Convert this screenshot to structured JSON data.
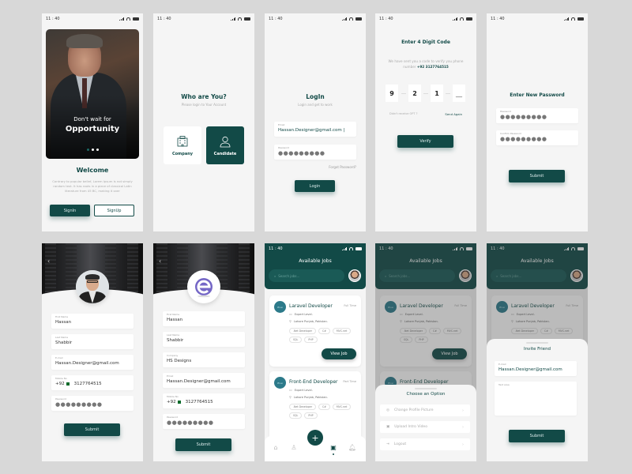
{
  "status_bar": {
    "time": "11 : 40"
  },
  "colors": {
    "primary": "#124a47",
    "background": "#f5f5f5",
    "canvas": "#d8d8d8"
  },
  "screens": {
    "welcome": {
      "hero_line1": "Don't wait for",
      "hero_line2": "Opportunity",
      "pager": {
        "count": 3,
        "active": 1
      },
      "title": "Welcome",
      "body": "Contrary to popular belief, Lorem Ipsum is not simply random text. It has roots in a piece of classical Latin literature from 45 BC, making it over",
      "signin_label": "SignIn",
      "signup_label": "SignUp"
    },
    "role": {
      "title": "Who are You?",
      "subtitle": "Please login to Your Account",
      "options": [
        {
          "label": "Company",
          "icon": "building-icon",
          "selected": false
        },
        {
          "label": "Candidate",
          "icon": "person-icon",
          "selected": true
        }
      ]
    },
    "login": {
      "title": "LogIn",
      "subtitle": "Login and get to work",
      "email_label": "Email",
      "email_value": "Hassan.Designer@gmail.com",
      "password_label": "Password",
      "password_value": "●●●●●●●●●",
      "forgot_label": "Forgot Password?",
      "login_label": "Login"
    },
    "otp": {
      "title": "Enter 4 Digit Code",
      "message": "We have sent you a code to verify you phone number",
      "phone": "+92 3127764515",
      "digits": [
        "9",
        "2",
        "1",
        "__"
      ],
      "didnt_receive": "Didn't receive OPT ?",
      "send_again": "Send Again",
      "verify_label": "Verify"
    },
    "new_password": {
      "title": "Enter New Password",
      "password_label": "Password",
      "password_value": "●●●●●●●●●",
      "confirm_label": "Confirm Password",
      "confirm_value": "●●●●●●●●●",
      "submit_label": "Submit"
    },
    "candidate_profile": {
      "fields": [
        {
          "label": "First Name",
          "value": "Hassan"
        },
        {
          "label": "Last Name",
          "value": "Shabbir"
        },
        {
          "label": "E-mail",
          "value": "Hassan.Designer@gmail.com"
        },
        {
          "label": "Mobile No",
          "code": "+92",
          "value": "3127764515"
        },
        {
          "label": "Password",
          "value": "●●●●●●●●●"
        }
      ],
      "submit_label": "Submit"
    },
    "company_profile": {
      "fields": [
        {
          "label": "First Name",
          "value": "Hassan"
        },
        {
          "label": "Last Name",
          "value": "Shabbir"
        },
        {
          "label": "Company",
          "value": "HS Designs"
        },
        {
          "label": "Email",
          "value": "Hassan.Designer@gmail.com"
        },
        {
          "label": "Mobile No",
          "code": "+92",
          "value": "3127764515"
        },
        {
          "label": "Password",
          "value": "●●●●●●●●●"
        }
      ],
      "submit_label": "Submit"
    },
    "jobs": {
      "title": "Available Jobs",
      "search_placeholder": "Search jobs...",
      "logo_text": "Blue",
      "cards": [
        {
          "title": "Laravel Developer",
          "type": "Full Time",
          "level": "Expert Level.",
          "location": "Lahore Punjab, Pakistan.",
          "tags": [
            ".Net Developer",
            "C#",
            "MVC.net",
            "SQL",
            "PHP"
          ],
          "action": "View Job"
        },
        {
          "title": "Front-End Developer",
          "type": "Part Time",
          "level": "Expert Level.",
          "location": "Lahore Punjab, Pakistan.",
          "tags": [
            ".Net Developer",
            "C#",
            "MVC.net",
            "SQL",
            "PHP"
          ]
        }
      ],
      "fab_label": "+",
      "tabs": [
        "home-icon",
        "profile-icon",
        "briefcase-icon",
        "bell-icon"
      ],
      "active_tab": 2
    },
    "options_sheet": {
      "title": "Choose an Option",
      "options": [
        {
          "label": "Change Profile Picture",
          "icon": "camera-icon"
        },
        {
          "label": "Upload Intro Video",
          "icon": "video-icon"
        },
        {
          "label": "Logout",
          "icon": "logout-icon"
        }
      ]
    },
    "invite_sheet": {
      "title": "Invite Friend",
      "email_label": "E-mail",
      "email_value": "Hassan.Designer@gmail.com",
      "text_label": "Text area",
      "text_value": "",
      "submit_label": "Submit"
    }
  }
}
